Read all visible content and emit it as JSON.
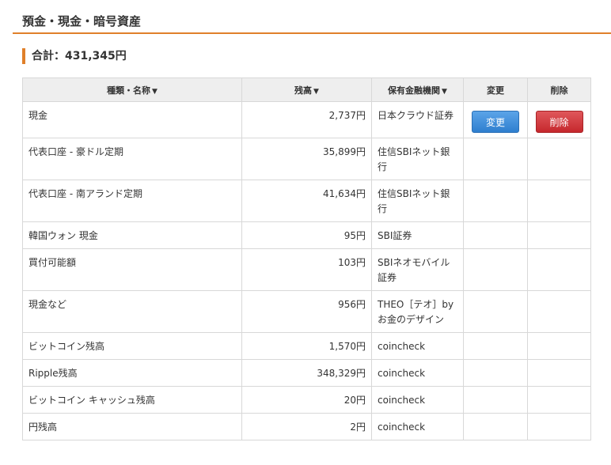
{
  "section": {
    "title": "預金・現金・暗号資産",
    "total_label": "合計：431,345円"
  },
  "table": {
    "headers": {
      "name": "種類・名称",
      "balance": "残高",
      "institution": "保有金融機関",
      "edit": "変更",
      "delete": "削除"
    },
    "sort_arrow": "▼",
    "edit_button": "変更",
    "delete_button": "削除",
    "rows": [
      {
        "name": "現金",
        "balance": "2,737円",
        "institution": "日本クラウド証券"
      },
      {
        "name": "代表口座 - 豪ドル定期",
        "balance": "35,899円",
        "institution": "住信SBIネット銀行"
      },
      {
        "name": "代表口座 - 南アランド定期",
        "balance": "41,634円",
        "institution": "住信SBIネット銀行"
      },
      {
        "name": "韓国ウォン 現金",
        "balance": "95円",
        "institution": "SBI証券"
      },
      {
        "name": "買付可能額",
        "balance": "103円",
        "institution": "SBIネオモバイル証券"
      },
      {
        "name": "現金など",
        "balance": "956円",
        "institution": "THEO［テオ］by お金のデザイン"
      },
      {
        "name": "ビットコイン残高",
        "balance": "1,570円",
        "institution": "coincheck"
      },
      {
        "name": "Ripple残高",
        "balance": "348,329円",
        "institution": "coincheck"
      },
      {
        "name": "ビットコイン キャッシュ残高",
        "balance": "20円",
        "institution": "coincheck"
      },
      {
        "name": "円残高",
        "balance": "2円",
        "institution": "coincheck"
      }
    ]
  },
  "colors": {
    "accent": "#e0802a",
    "edit_button": "#2f7fcf",
    "delete_button": "#c6282d",
    "header_bg": "#eeeeee"
  }
}
